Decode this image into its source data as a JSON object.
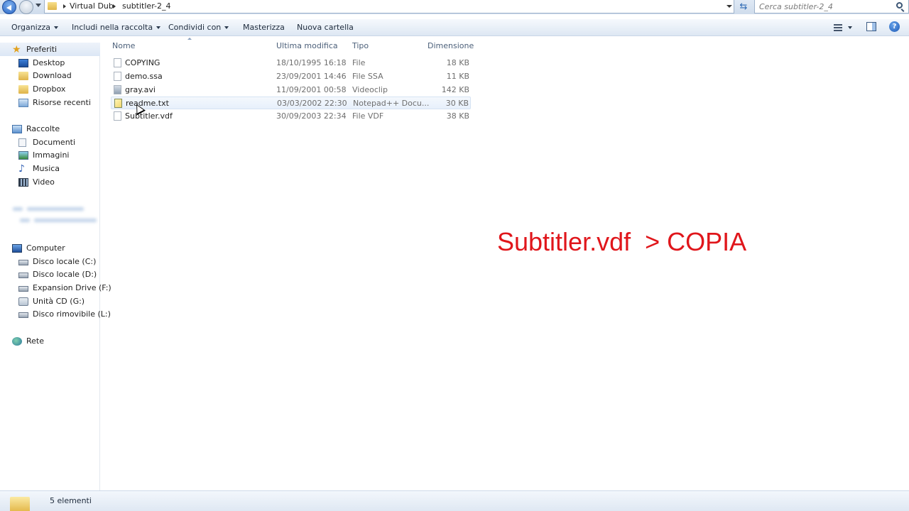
{
  "address_bar": {
    "breadcrumbs": [
      "Virtual Dub",
      "subtitler-2_4"
    ],
    "search_placeholder": "Cerca subtitler-2_4"
  },
  "toolbar": {
    "organize": "Organizza",
    "include_library": "Includi nella raccolta",
    "share_with": "Condividi con",
    "burn": "Masterizza",
    "new_folder": "Nuova cartella"
  },
  "nav": {
    "favorites": {
      "label": "Preferiti",
      "items": [
        "Desktop",
        "Download",
        "Dropbox",
        "Risorse recenti"
      ]
    },
    "libraries": {
      "label": "Raccolte",
      "items": [
        "Documenti",
        "Immagini",
        "Musica",
        "Video"
      ]
    },
    "computer": {
      "label": "Computer",
      "items": [
        "Disco locale (C:)",
        "Disco locale (D:)",
        "Expansion Drive (F:)",
        "Unità CD (G:)",
        "Disco rimovibile (L:)"
      ]
    },
    "network": {
      "label": "Rete"
    }
  },
  "columns": {
    "name": "Nome",
    "modified": "Ultima modifica",
    "type": "Tipo",
    "size": "Dimensione"
  },
  "files": [
    {
      "name": "COPYING",
      "modified": "18/10/1995 16:18",
      "type": "File",
      "size": "18 KB",
      "icon": "generic-file-icon"
    },
    {
      "name": "demo.ssa",
      "modified": "23/09/2001 14:46",
      "type": "File SSA",
      "size": "11 KB",
      "icon": "generic-file-icon"
    },
    {
      "name": "gray.avi",
      "modified": "11/09/2001 00:58",
      "type": "Videoclip",
      "size": "142 KB",
      "icon": "video-file-icon"
    },
    {
      "name": "readme.txt",
      "modified": "03/03/2002 22:30",
      "type": "Notepad++ Docu...",
      "size": "30 KB",
      "icon": "notepad-file-icon"
    },
    {
      "name": "Subtitler.vdf",
      "modified": "30/09/2003 22:34",
      "type": "File VDF",
      "size": "38 KB",
      "icon": "generic-file-icon"
    }
  ],
  "caption": "Subtitler.vdf  > COPIA",
  "status": {
    "count_text": "5 elementi"
  },
  "colors": {
    "caption": "#e0161b",
    "accent": "#2a66c6",
    "hover_row": "#e7f0fb"
  }
}
